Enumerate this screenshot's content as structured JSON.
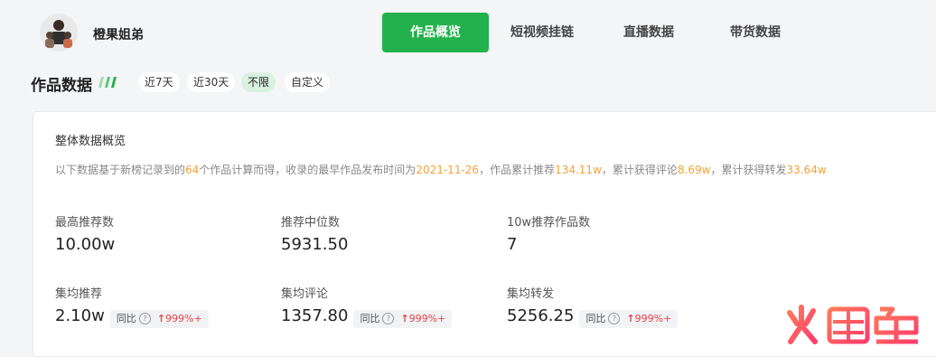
{
  "account": {
    "name": "橙果姐弟"
  },
  "tabs": [
    {
      "label": "作品概览",
      "active": true
    },
    {
      "label": "短视频挂链",
      "active": false
    },
    {
      "label": "直播数据",
      "active": false
    },
    {
      "label": "带货数据",
      "active": false
    }
  ],
  "section": {
    "title": "作品数据"
  },
  "filters": [
    {
      "label": "近7天",
      "active": false
    },
    {
      "label": "近30天",
      "active": false
    },
    {
      "label": "不限",
      "active": true
    },
    {
      "label": "自定义",
      "active": false
    }
  ],
  "overview": {
    "title": "整体数据概览",
    "desc": {
      "p1": "以下数据基于新榜记录到的",
      "works_count": "64",
      "p2": "个作品计算而得，收录的最早作品发布时间为",
      "earliest_date": "2021-11-26",
      "p3": "，作品累计推荐",
      "total_recommend": "134.11w",
      "p4": "，累计获得评论",
      "total_comments": "8.69w",
      "p5": "，累计获得转发",
      "total_shares": "33.64w"
    }
  },
  "metrics": [
    {
      "label": "最高推荐数",
      "value": "10.00w"
    },
    {
      "label": "推荐中位数",
      "value": "5931.50"
    },
    {
      "label": "10w推荐作品数",
      "value": "7"
    },
    {
      "label": "集均推荐",
      "value": "2.10w",
      "yoy_label": "同比",
      "yoy_value": "999%+"
    },
    {
      "label": "集均评论",
      "value": "1357.80",
      "yoy_label": "同比",
      "yoy_value": "999%+"
    },
    {
      "label": "集均转发",
      "value": "5256.25",
      "yoy_label": "同比",
      "yoy_value": "999%+"
    }
  ],
  "watermark": {
    "text": "火鲤鱼"
  },
  "colors": {
    "accent": "#22b14c",
    "highlight": "#f2a33a",
    "up": "#e8424a"
  }
}
